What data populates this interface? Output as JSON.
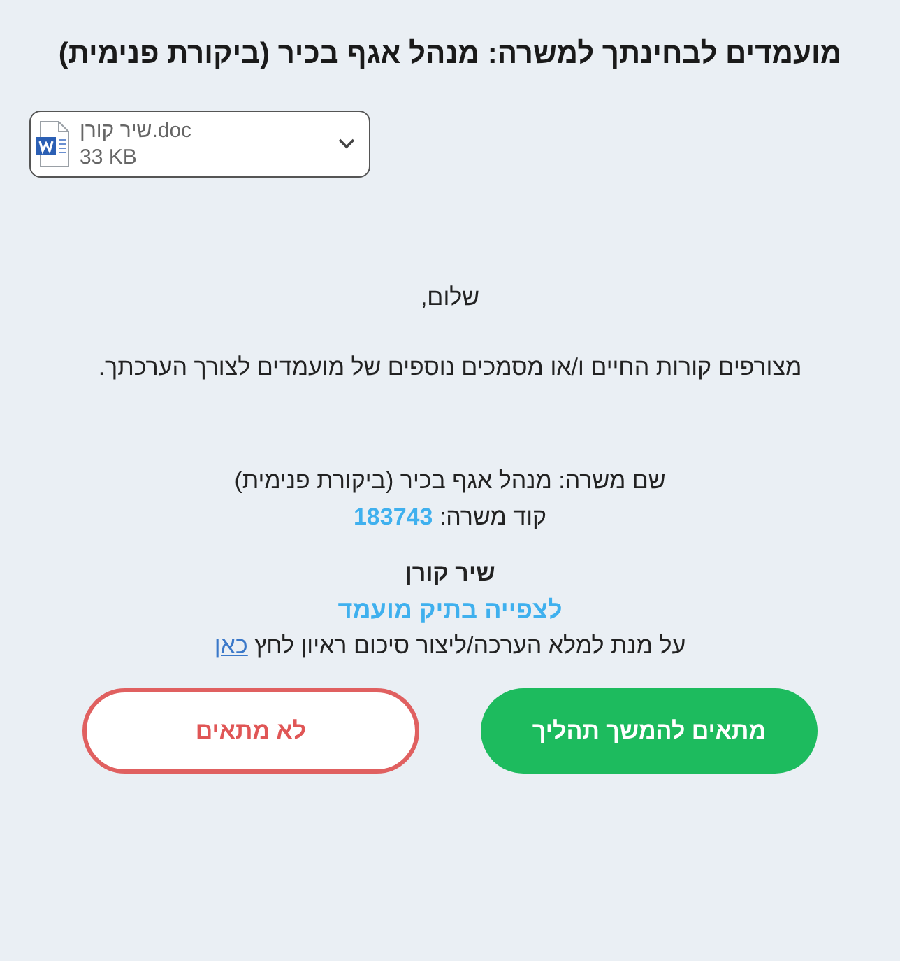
{
  "title": "מועמדים לבחינתך למשרה: מנהל אגף בכיר (ביקורת פנימית)",
  "attachment": {
    "file_name": "שיר קורן.doc",
    "size": "33 KB"
  },
  "greeting": "שלום,",
  "body": "מצורפים קורות החיים ו/או מסמכים נוספים של מועמדים לצורך הערכתך.",
  "job_name": "שם משרה: מנהל אגף בכיר (ביקורת פנימית)",
  "job_code": {
    "label": "קוד משרה:",
    "value": "183743"
  },
  "candidate_name": "שיר קורן",
  "candidate_link": "לצפייה בתיק מועמד",
  "instruction": {
    "text": "על מנת למלא הערכה/ליצור סיכום ראיון לחץ",
    "link": "כאן"
  },
  "buttons": [
    {
      "label": "מתאים להמשך תהליך",
      "kind": "primary"
    },
    {
      "label": "לא מתאים",
      "kind": "outline"
    }
  ]
}
